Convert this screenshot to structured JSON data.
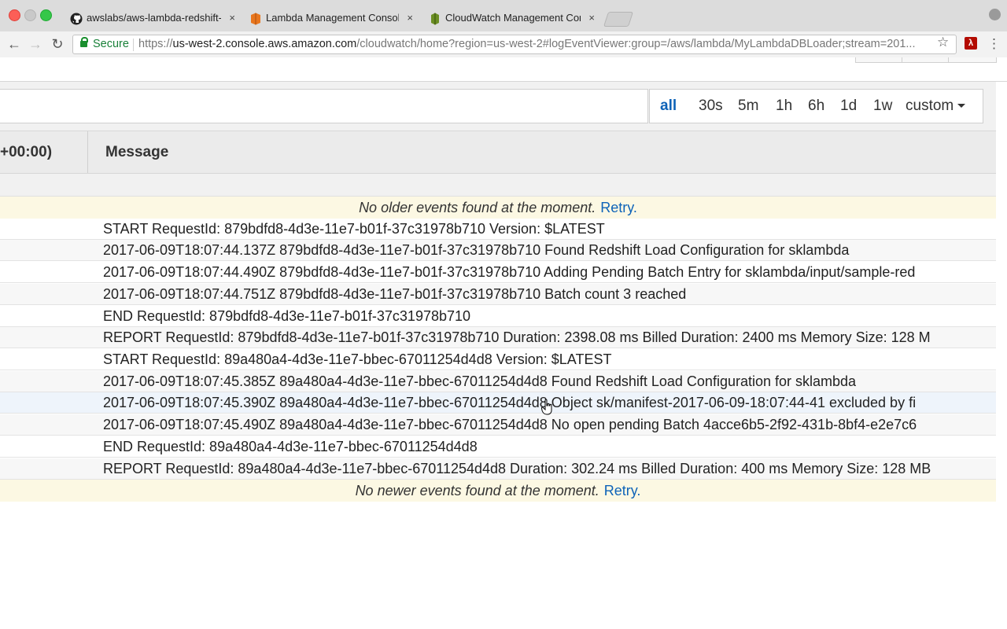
{
  "browser": {
    "tabs": [
      {
        "title": "awslabs/aws-lambda-redshift-",
        "icon": "github-icon"
      },
      {
        "title": "Lambda Management Console",
        "icon": "aws-lambda-icon"
      },
      {
        "title": "CloudWatch Management Con",
        "icon": "aws-cloudwatch-icon",
        "active": true
      }
    ],
    "close_glyph": "×",
    "secure_label": "Secure",
    "url_scheme": "https://",
    "url_host": "us-west-2.console.aws.amazon.com",
    "url_path": "/cloudwatch/home?region=us-west-2#logEventViewer:group=/aws/lambda/MyLambdaDBLoader;stream=201..."
  },
  "filter": {
    "ranges": [
      "all",
      "30s",
      "5m",
      "1h",
      "6h",
      "1d",
      "1w",
      "custom"
    ],
    "active_range": "all"
  },
  "table": {
    "time_header": "+00:00)",
    "message_header": "Message",
    "top_notice": "No older events found at the moment.",
    "bottom_notice": "No newer events found at the moment.",
    "retry_label": "Retry.",
    "rows": [
      "START RequestId: 879bdfd8-4d3e-11e7-b01f-37c31978b710 Version: $LATEST",
      "2017-06-09T18:07:44.137Z 879bdfd8-4d3e-11e7-b01f-37c31978b710 Found Redshift Load Configuration for sklambda",
      "2017-06-09T18:07:44.490Z 879bdfd8-4d3e-11e7-b01f-37c31978b710 Adding Pending Batch Entry for sklambda/input/sample-red",
      "2017-06-09T18:07:44.751Z 879bdfd8-4d3e-11e7-b01f-37c31978b710 Batch count 3 reached",
      "END RequestId: 879bdfd8-4d3e-11e7-b01f-37c31978b710",
      "REPORT RequestId: 879bdfd8-4d3e-11e7-b01f-37c31978b710 Duration: 2398.08 ms Billed Duration: 2400 ms Memory Size: 128 M",
      "START RequestId: 89a480a4-4d3e-11e7-bbec-67011254d4d8 Version: $LATEST",
      "2017-06-09T18:07:45.385Z 89a480a4-4d3e-11e7-bbec-67011254d4d8 Found Redshift Load Configuration for sklambda",
      "2017-06-09T18:07:45.390Z 89a480a4-4d3e-11e7-bbec-67011254d4d8 Object sk/manifest-2017-06-09-18:07:44-41 excluded by fi",
      "2017-06-09T18:07:45.490Z 89a480a4-4d3e-11e7-bbec-67011254d4d8 No open pending Batch 4acce6b5-2f92-431b-8bf4-e2e7c6",
      "END RequestId: 89a480a4-4d3e-11e7-bbec-67011254d4d8",
      "REPORT RequestId: 89a480a4-4d3e-11e7-bbec-67011254d4d8 Duration: 302.24 ms Billed Duration: 400 ms Memory Size: 128 MB"
    ]
  },
  "colors": {
    "link": "#0e63b8",
    "notice_bg": "#fcf8e3",
    "secure_green": "#188038"
  }
}
